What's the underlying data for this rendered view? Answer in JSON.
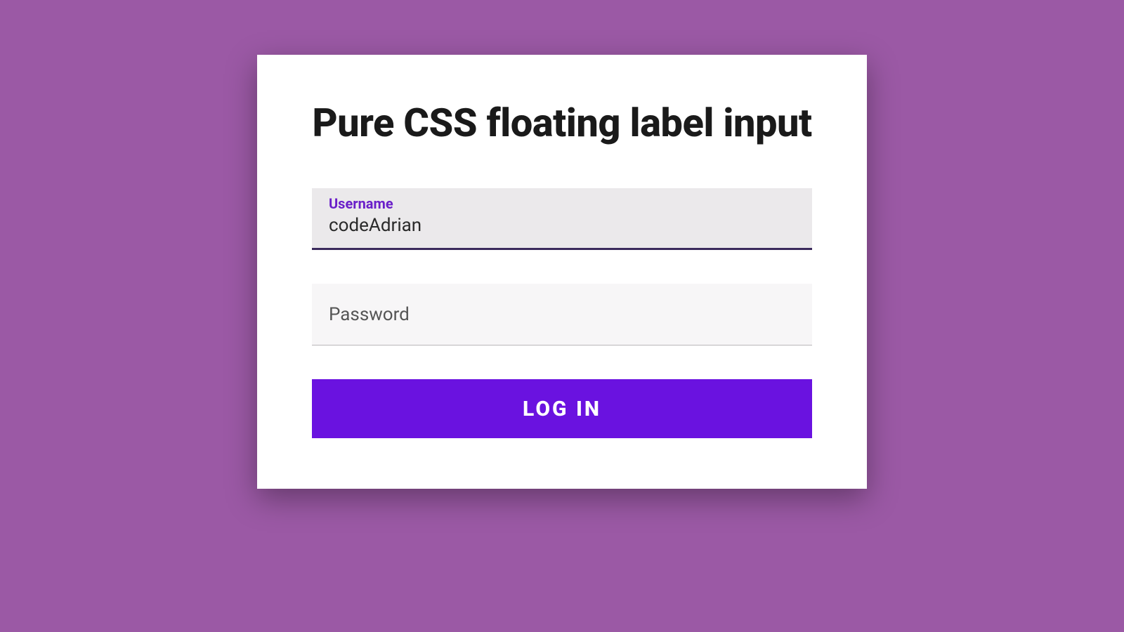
{
  "form": {
    "title": "Pure CSS floating label input",
    "username": {
      "label": "Username",
      "value": "codeAdrian"
    },
    "password": {
      "label": "Password",
      "value": ""
    },
    "submit_label": "LOG IN"
  },
  "colors": {
    "page_background": "#9b59a5",
    "card_background": "#ffffff",
    "input_filled_background": "#ebe9eb",
    "input_empty_background": "#f7f6f7",
    "floating_label": "#6a1fc9",
    "input_underline_active": "#3b2a5c",
    "button_background": "#6a12e0",
    "button_text": "#ffffff"
  }
}
